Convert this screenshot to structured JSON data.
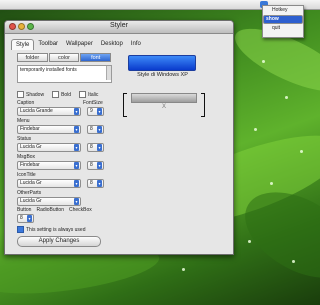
{
  "desktop": {
    "background": "green leaf wallpaper with water drops"
  },
  "tray_menu": {
    "items": [
      {
        "label": "Hotkey"
      },
      {
        "label": "show"
      },
      {
        "label": "quit"
      }
    ]
  },
  "window": {
    "title": "Styler"
  },
  "tabs": [
    {
      "label": "Style"
    },
    {
      "label": "Toolbar"
    },
    {
      "label": "Wallpaper"
    },
    {
      "label": "Desktop"
    },
    {
      "label": "Info"
    }
  ],
  "style_tab": {
    "segmented": {
      "folder": "folder",
      "color": "color",
      "font": "font"
    },
    "font_list_text": "temporarily installed fonts",
    "checks": {
      "shadow": "Shadow",
      "bold": "Bold",
      "italic": "Italic"
    },
    "font_header": {
      "caption": "Caption",
      "font_size": "FontSize"
    },
    "fields": [
      {
        "label": "Caption",
        "font": "Lucida Grande",
        "size": "9"
      },
      {
        "label": "Menu",
        "font": "Findebar",
        "size": "8"
      },
      {
        "label": "Status",
        "font": "Lucida Gr",
        "size": "8"
      },
      {
        "label": "MsgBox",
        "font": "Findebar",
        "size": "8"
      },
      {
        "label": "IconTitle",
        "font": "Lucida Gr",
        "size": "8"
      },
      {
        "label": "OtherParts",
        "font": "Lucida Gr",
        "size": ""
      }
    ],
    "lower_labels": {
      "button": "Button",
      "radio": "RadioButton",
      "check": "CheckBox"
    },
    "button_size": "8",
    "always_used": "This setting is always used",
    "apply": "Apply Changes"
  },
  "preview": {
    "style_name": "Style di Windows XP",
    "close_mark": "X"
  }
}
